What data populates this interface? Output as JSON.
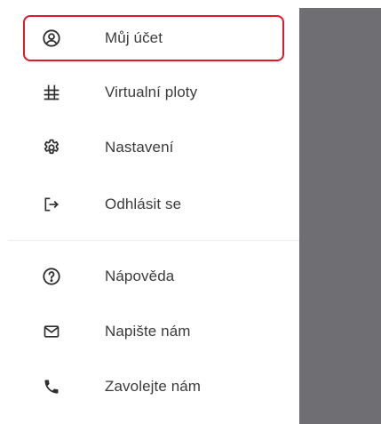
{
  "drawer": {
    "primary_items": [
      {
        "label": "Můj účet",
        "icon": "account-circle-icon",
        "highlighted": true
      },
      {
        "label": "Virtualní ploty",
        "icon": "grid-fence-icon",
        "highlighted": false
      },
      {
        "label": "Nastavení",
        "icon": "gear-icon",
        "highlighted": false
      },
      {
        "label": "Odhlásit se",
        "icon": "logout-icon",
        "highlighted": false
      }
    ],
    "secondary_items": [
      {
        "label": "Nápověda",
        "icon": "help-icon"
      },
      {
        "label": "Napište nám",
        "icon": "mail-icon"
      },
      {
        "label": "Zavolejte nám",
        "icon": "phone-icon"
      }
    ]
  },
  "colors": {
    "highlight_border": "#e0192a",
    "overlay": "#6f6f73",
    "text": "#3b3b3b",
    "icon": "#2f2f2f"
  }
}
